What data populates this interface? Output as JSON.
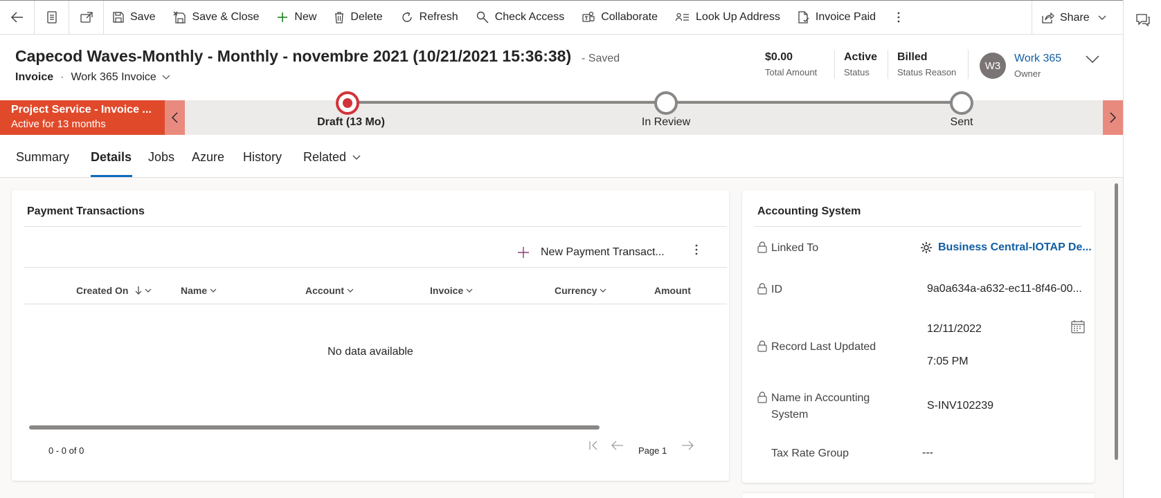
{
  "command_bar": {
    "save": "Save",
    "save_close": "Save & Close",
    "new": "New",
    "delete": "Delete",
    "refresh": "Refresh",
    "check_access": "Check Access",
    "collaborate": "Collaborate",
    "look_up_address": "Look Up Address",
    "invoice_paid": "Invoice Paid",
    "share": "Share"
  },
  "header": {
    "title": "Capecod Waves-Monthly - Monthly - novembre 2021 (10/21/2021 15:36:38)",
    "saved_status": "- Saved",
    "entity": "Invoice",
    "separator": "·",
    "form_name": "Work 365 Invoice",
    "total_amount_value": "$0.00",
    "total_amount_label": "Total Amount",
    "status_value": "Active",
    "status_label": "Status",
    "status_reason_value": "Billed",
    "status_reason_label": "Status Reason",
    "owner_initials": "W3",
    "owner_name": "Work 365",
    "owner_label": "Owner"
  },
  "bpf": {
    "active_name": "Project Service - Invoice ...",
    "active_duration": "Active for 13 months",
    "stages": [
      {
        "label": "Draft  (13 Mo)",
        "active": true
      },
      {
        "label": "In Review",
        "active": false
      },
      {
        "label": "Sent",
        "active": false
      }
    ]
  },
  "tabs": [
    {
      "label": "Summary"
    },
    {
      "label": "Details",
      "selected": true
    },
    {
      "label": "Jobs"
    },
    {
      "label": "Azure"
    },
    {
      "label": "History"
    },
    {
      "label": "Related"
    }
  ],
  "payment_transactions": {
    "title": "Payment Transactions",
    "new_button": "New Payment Transact...",
    "columns": [
      "Created On",
      "Name",
      "Account",
      "Invoice",
      "Currency",
      "Amount"
    ],
    "empty_message": "No data available",
    "record_count": "0 - 0 of 0",
    "page_label": "Page 1"
  },
  "accounting_system": {
    "title": "Accounting System",
    "linked_to_label": "Linked To",
    "linked_to_value": "Business Central-IOTAP De...",
    "id_label": "ID",
    "id_value": "9a0a634a-a632-ec11-8f46-00...",
    "record_last_updated_label": "Record Last Updated",
    "record_last_updated_date": "12/11/2022",
    "record_last_updated_time": "7:05 PM",
    "name_in_accounting_label_line1": "Name in Accounting",
    "name_in_accounting_label_line2": "System",
    "name_in_accounting_value": "S-INV102239",
    "tax_rate_group_label": "Tax Rate Group",
    "tax_rate_group_value": "---"
  },
  "colors": {
    "accent": "#0f6cbd",
    "link": "#115ea3",
    "bpf_active": "#e04a2b",
    "stage_active": "#d13438"
  }
}
